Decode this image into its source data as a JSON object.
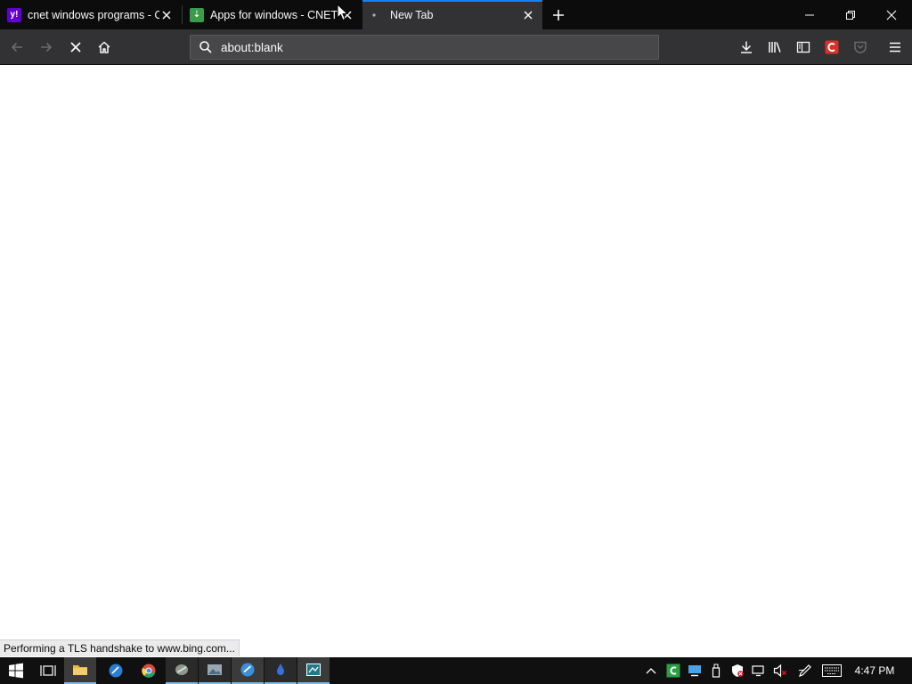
{
  "tabs": [
    {
      "title": "cnet windows programs - C",
      "favicon": "yahoo-favicon",
      "favicon_color": "#6001d2",
      "favicon_letter": "y!"
    },
    {
      "title": "Apps for windows - CNET D",
      "favicon": "cnet-download-favicon",
      "favicon_color": "#3a9b4a",
      "favicon_letter": "⇣"
    },
    {
      "title": "New Tab",
      "favicon": "loading-dot",
      "active": true
    }
  ],
  "navbar": {
    "url": "about:blank",
    "back_icon": "back-arrow-icon",
    "forward_icon": "forward-arrow-icon",
    "stop_icon": "stop-icon",
    "home_icon": "home-icon"
  },
  "toolbar_icons": [
    "downloads-icon",
    "library-icon",
    "sidebar-icon",
    "cyberlink-extension-icon",
    "pocket-icon",
    "menu-icon"
  ],
  "status": "Performing a TLS handshake to www.bing.com...",
  "taskbar": {
    "apps": [
      "start-icon",
      "task-view-icon",
      "file-explorer-icon",
      "browser-icon",
      "chrome-icon",
      "app-icon",
      "photos-icon",
      "ie-icon",
      "edit-icon",
      "store-icon"
    ],
    "time": "4:47 PM"
  },
  "colors": {
    "accent": "#0a84ff",
    "tabbar_bg": "#0c0c0d",
    "toolbar_bg": "#323234",
    "urlbar_bg": "#474749",
    "taskbar_bg": "#101010"
  }
}
